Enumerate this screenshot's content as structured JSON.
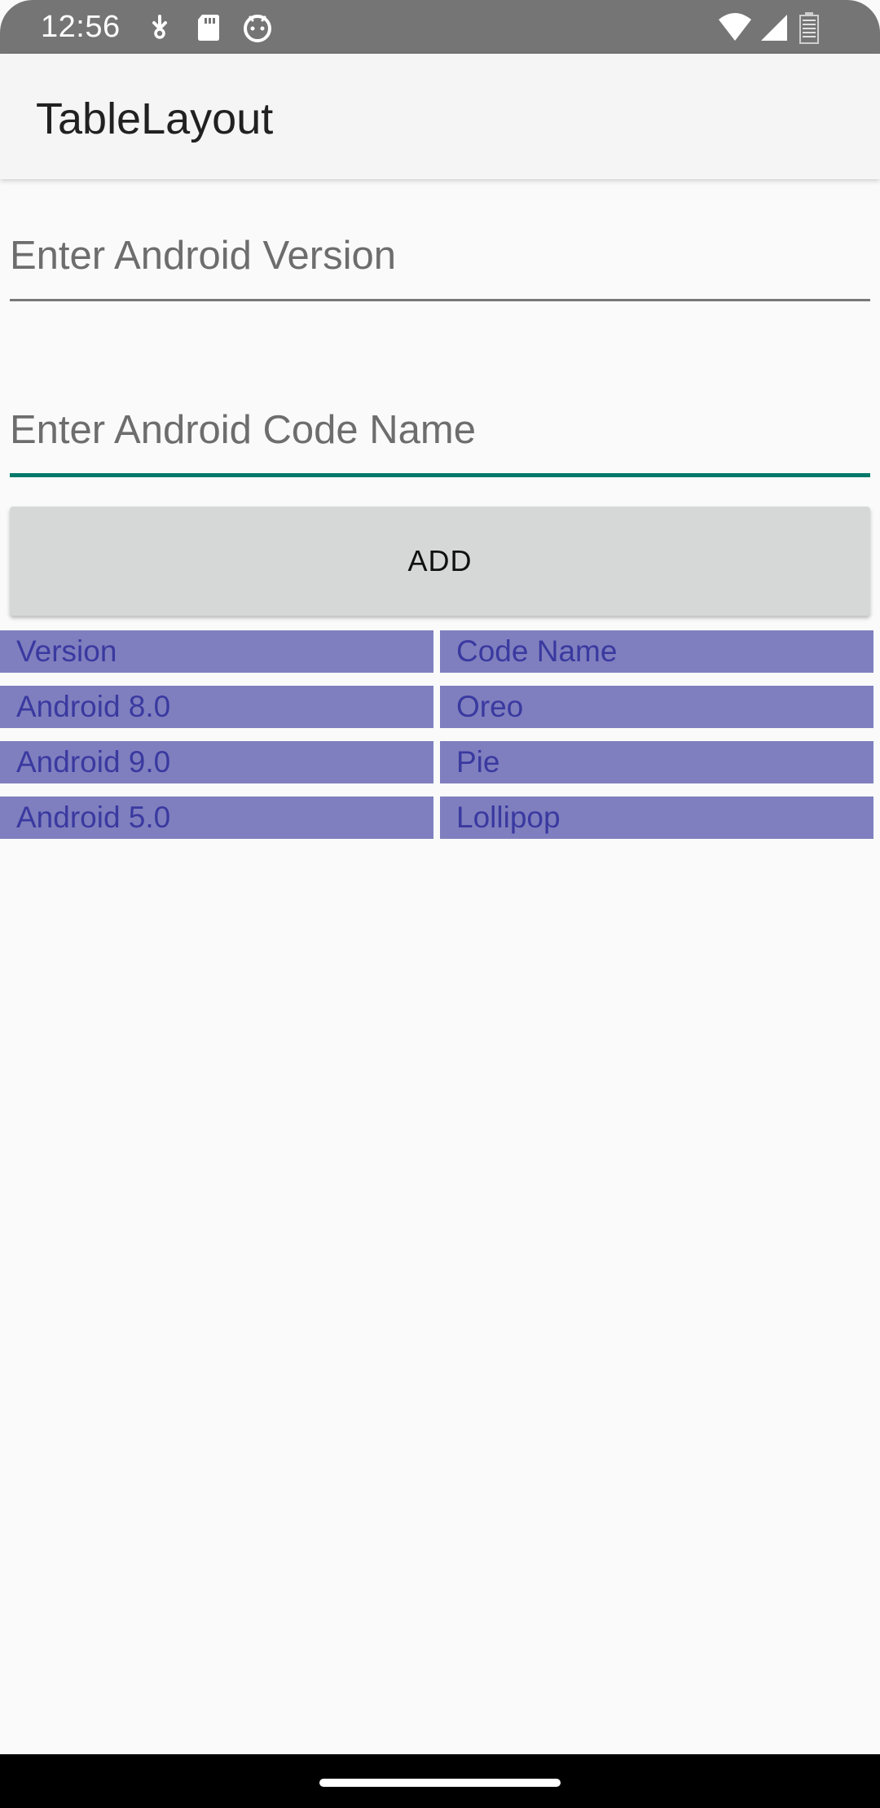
{
  "status_bar": {
    "time": "12:56",
    "left_icons": [
      "download-icon",
      "sd-card-icon",
      "android-debug-icon"
    ],
    "right_icons": [
      "wifi-icon",
      "cell-signal-icon",
      "battery-icon"
    ]
  },
  "app_bar": {
    "title": "TableLayout"
  },
  "form": {
    "version_placeholder": "Enter Android Version",
    "version_value": "",
    "codename_placeholder": "Enter Android Code Name",
    "codename_value": "",
    "add_label": "ADD"
  },
  "table": {
    "rows": [
      {
        "version": "Version",
        "code_name": "Code Name"
      },
      {
        "version": "Android 8.0",
        "code_name": "Oreo"
      },
      {
        "version": "Android 9.0",
        "code_name": "Pie"
      },
      {
        "version": "Android 5.0",
        "code_name": "Lollipop"
      }
    ]
  },
  "colors": {
    "cell_background": "#7f7fbf",
    "cell_text": "#3a39a0",
    "accent": "#00796b",
    "status_bar": "#757575"
  }
}
